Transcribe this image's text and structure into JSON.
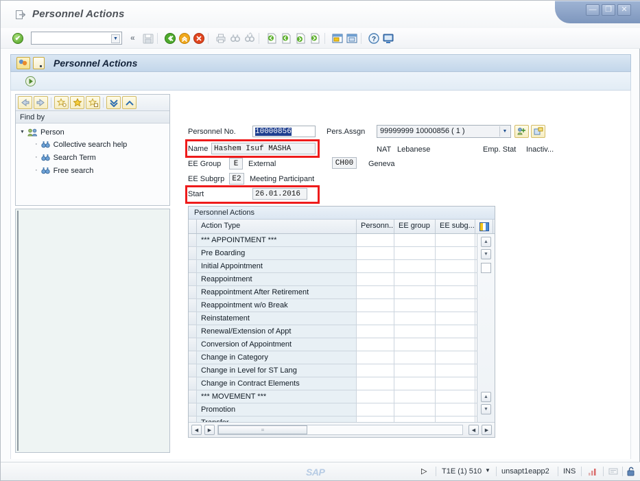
{
  "window": {
    "title": "Personnel Actions",
    "controls": {
      "minimize": "—",
      "restore": "❐",
      "close": "✕"
    }
  },
  "toolbar": {
    "ok_label": "✔",
    "command_value": "",
    "command_placeholder": "",
    "dropdown_arrow": "▼",
    "back_chevron": "«",
    "icons": [
      {
        "name": "save-icon",
        "glyph": "save"
      },
      {
        "name": "back-icon",
        "glyph": "back"
      },
      {
        "name": "exit-icon",
        "glyph": "exit"
      },
      {
        "name": "cancel-icon",
        "glyph": "cancel"
      },
      {
        "name": "print-icon",
        "glyph": "print"
      },
      {
        "name": "find-icon",
        "glyph": "find"
      },
      {
        "name": "find-next-icon",
        "glyph": "find-next"
      },
      {
        "name": "first-page-icon",
        "glyph": "first"
      },
      {
        "name": "previous-page-icon",
        "glyph": "prev"
      },
      {
        "name": "next-page-icon",
        "glyph": "next"
      },
      {
        "name": "last-page-icon",
        "glyph": "last"
      },
      {
        "name": "create-session-icon",
        "glyph": "session"
      },
      {
        "name": "create-shortcut-icon",
        "glyph": "shortcut"
      },
      {
        "name": "help-icon",
        "glyph": "help"
      },
      {
        "name": "customize-layout-icon",
        "glyph": "layout"
      }
    ]
  },
  "screen_header": {
    "title": "Personnel Actions"
  },
  "app_toolbar": {
    "execute_label": "Execute"
  },
  "find_panel": {
    "title": "Find by",
    "toolbar_buttons": [
      {
        "name": "back-button",
        "glyph": "⬅"
      },
      {
        "name": "forward-button",
        "glyph": "➡"
      },
      {
        "name": "add-favorite-button",
        "glyph": "★"
      },
      {
        "name": "favorite-button",
        "glyph": "★"
      },
      {
        "name": "delete-favorite-button",
        "glyph": "★"
      },
      {
        "name": "expand-all-button",
        "glyph": "▼"
      },
      {
        "name": "collapse-all-button",
        "glyph": "▲"
      }
    ],
    "root": "Person",
    "items": [
      {
        "label": "Collective search help"
      },
      {
        "label": "Search Term"
      },
      {
        "label": "Free search"
      }
    ]
  },
  "form": {
    "personnel_no": {
      "label": "Personnel No.",
      "value": "10000856"
    },
    "name": {
      "label": "Name",
      "value": "Hashem Isuf MASHA"
    },
    "ee_group": {
      "label": "EE Group",
      "code": "E",
      "text": "External"
    },
    "ee_subgrp": {
      "label": "EE Subgrp",
      "code": "E2",
      "text": "Meeting Participant"
    },
    "start": {
      "label": "Start",
      "value": "26.01.2016"
    },
    "pers_assgn": {
      "label": "Pers.Assgn",
      "value": "99999999 10000856 ( 1 )"
    },
    "nat": {
      "label": "NAT",
      "value": "Lebanese"
    },
    "emp_stat": {
      "label": "Emp. Stat",
      "value": "Inactiv..."
    },
    "org": {
      "code": "CH00",
      "text": "Geneva"
    }
  },
  "table": {
    "caption": "Personnel Actions",
    "columns": [
      "Action Type",
      "Personn...",
      "EE group",
      "EE subg..."
    ],
    "rows": [
      {
        "action": "*** APPOINTMENT ***",
        "personn": "",
        "ee_group": "",
        "ee_subg": ""
      },
      {
        "action": "Pre Boarding",
        "personn": "",
        "ee_group": "",
        "ee_subg": ""
      },
      {
        "action": "Initial Appointment",
        "personn": "",
        "ee_group": "",
        "ee_subg": ""
      },
      {
        "action": "Reappointment",
        "personn": "",
        "ee_group": "",
        "ee_subg": ""
      },
      {
        "action": "Reappointment After Retirement",
        "personn": "",
        "ee_group": "",
        "ee_subg": ""
      },
      {
        "action": "Reappointment w/o Break",
        "personn": "",
        "ee_group": "",
        "ee_subg": ""
      },
      {
        "action": "Reinstatement",
        "personn": "",
        "ee_group": "",
        "ee_subg": ""
      },
      {
        "action": "Renewal/Extension of Appt",
        "personn": "",
        "ee_group": "",
        "ee_subg": ""
      },
      {
        "action": "Conversion of Appointment",
        "personn": "",
        "ee_group": "",
        "ee_subg": ""
      },
      {
        "action": "Change in Category",
        "personn": "",
        "ee_group": "",
        "ee_subg": ""
      },
      {
        "action": "Change in Level for ST Lang",
        "personn": "",
        "ee_group": "",
        "ee_subg": ""
      },
      {
        "action": "Change in Contract Elements",
        "personn": "",
        "ee_group": "",
        "ee_subg": ""
      },
      {
        "action": "*** MOVEMENT ***",
        "personn": "",
        "ee_group": "",
        "ee_subg": ""
      },
      {
        "action": "Promotion",
        "personn": "",
        "ee_group": "",
        "ee_subg": ""
      },
      {
        "action": "Transfer",
        "personn": "",
        "ee_group": "",
        "ee_subg": ""
      }
    ]
  },
  "status_bar": {
    "logo": "SAP",
    "system": "T1E (1) 510",
    "server": "unsapt1eapp2",
    "mode": "INS",
    "dropdown_arrow": "▼",
    "play_icon": "▷"
  },
  "colors": {
    "accent": "#1f3f8f",
    "annotation": "#ee1b1b",
    "header_blue": "#c3d6ea",
    "row_alt": "#e8f0f5"
  }
}
